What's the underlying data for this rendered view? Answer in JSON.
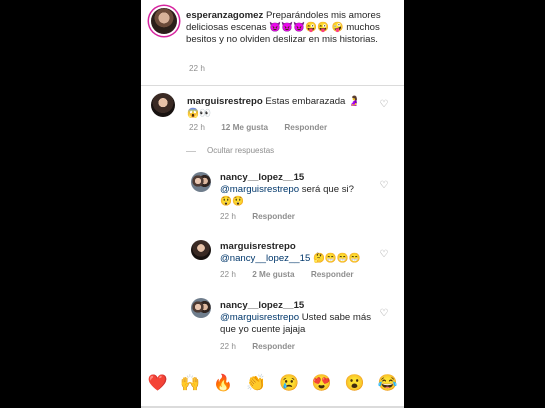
{
  "caption": {
    "username": "esperanzagomez",
    "text": "Preparándoles mis amores deliciosas escenas 😈😈😈😜😜 🤪 muchos besitos y no olviden deslizar en mis historias.",
    "time": "22 h"
  },
  "comments": [
    {
      "username": "marguisrestrepo",
      "text": "Estas embarazada 🤰",
      "text2": "😱👀",
      "time": "22 h",
      "likes": "12 Me gusta",
      "reply": "Responder"
    }
  ],
  "hide_replies": "Ocultar respuestas",
  "replies": [
    {
      "username": "nancy__lopez__15",
      "mention": "@marguisrestrepo",
      "text": "será que si?",
      "emoji": "😲😲",
      "time": "22 h",
      "reply": "Responder"
    },
    {
      "username": "marguisrestrepo",
      "mention": "@nancy__lopez__15",
      "emoji": "🤔😁😁😁",
      "time": "22 h",
      "likes": "2 Me gusta",
      "reply": "Responder"
    },
    {
      "username": "nancy__lopez__15",
      "mention": "@marguisrestrepo",
      "text": "Usted sabe más que yo cuente jajaja",
      "time": "22 h",
      "reply": "Responder"
    }
  ],
  "emoji_bar": [
    "❤️",
    "🙌",
    "🔥",
    "👏",
    "😢",
    "😍",
    "😮",
    "😂"
  ],
  "icons": {
    "like": "heart-outline-icon"
  },
  "colors": {
    "background": "#000000",
    "panel": "#ffffff",
    "link": "#00376b",
    "meta": "#8e8e8e"
  }
}
